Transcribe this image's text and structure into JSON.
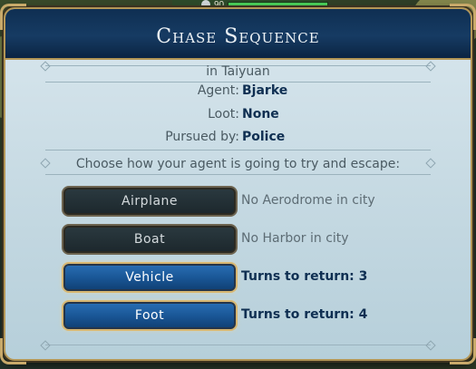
{
  "hud": {
    "strength": "90"
  },
  "dialog": {
    "title": "Chase Sequence",
    "location": "in Taiyuan",
    "fields": [
      {
        "label": "Agent:",
        "value": "Bjarke"
      },
      {
        "label": "Loot:",
        "value": "None"
      },
      {
        "label": "Pursued by:",
        "value": "Police"
      }
    ],
    "prompt": "Choose how your agent is going to try and escape:",
    "options": [
      {
        "label": "Airplane",
        "note": "No Aerodrome in city",
        "enabled": false
      },
      {
        "label": "Boat",
        "note": "No Harbor in city",
        "enabled": false
      },
      {
        "label": "Vehicle",
        "note": "Turns to return: 3",
        "enabled": true
      },
      {
        "label": "Foot",
        "note": "Turns to return: 4",
        "enabled": true
      }
    ]
  },
  "colors": {
    "header_blue": "#163b63",
    "panel_light": "#c5d9e2",
    "gold_trim": "#b39656",
    "button_enabled": "#1a5797",
    "button_disabled": "#1c272c"
  }
}
